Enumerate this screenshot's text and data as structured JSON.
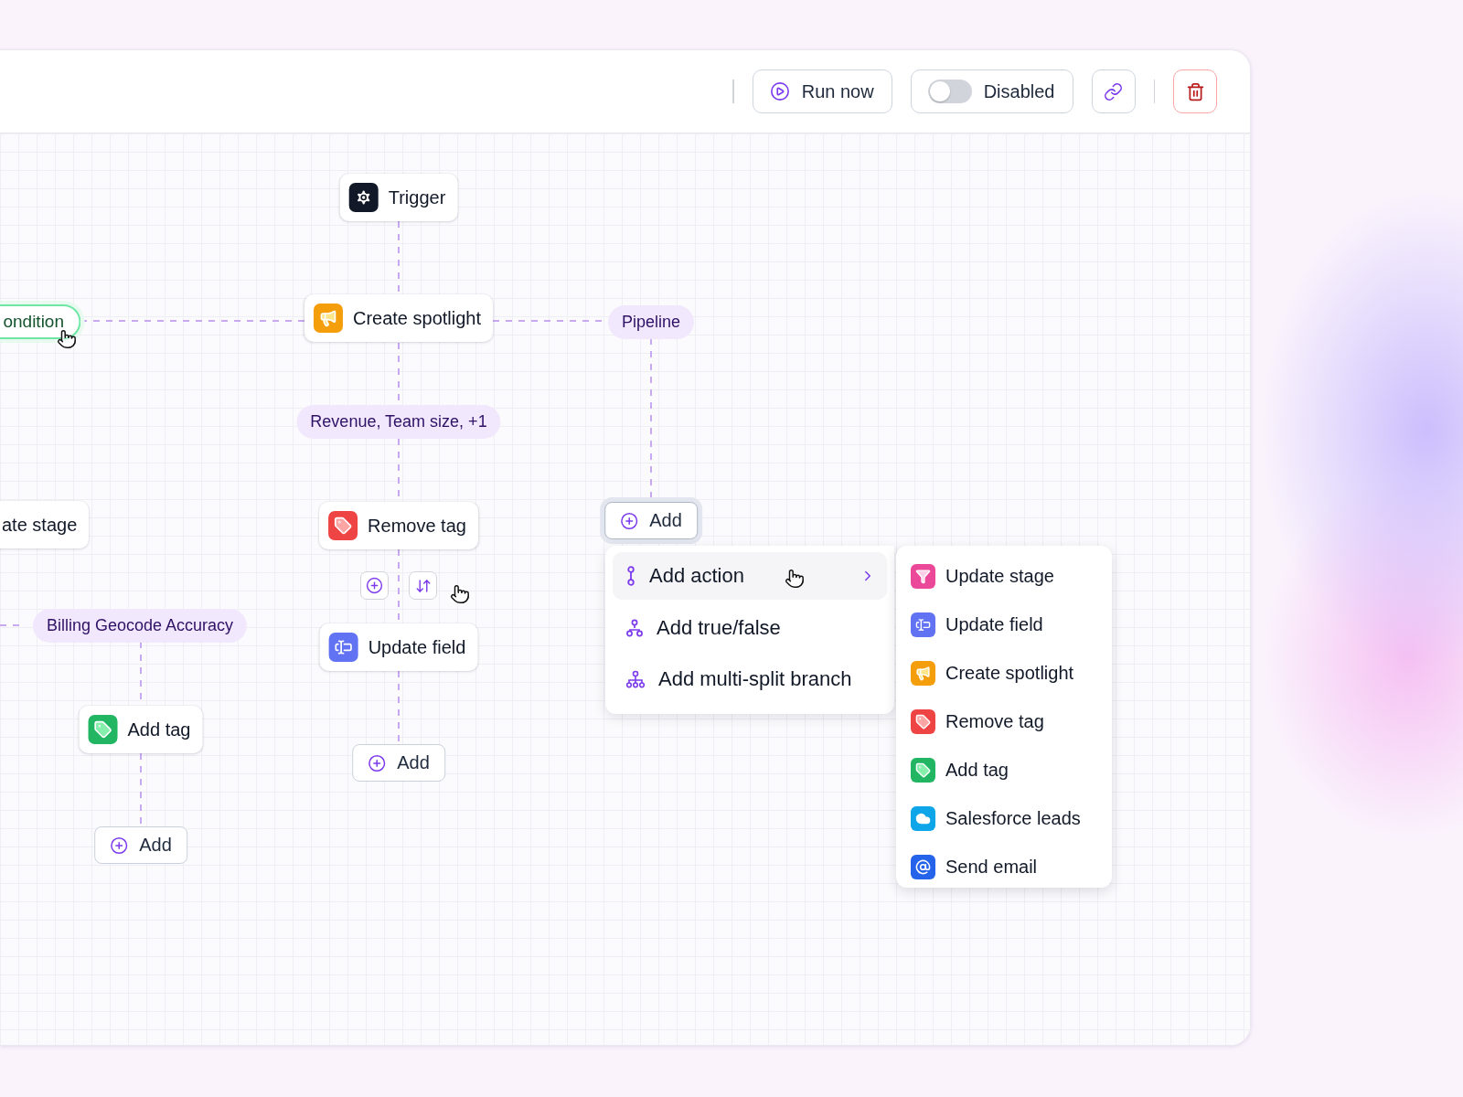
{
  "toolbar": {
    "run_button": {
      "label": "Run now"
    },
    "status_toggle": {
      "label": "Disabled",
      "on": false
    }
  },
  "canvas": {
    "nodes": [
      {
        "kind": "step",
        "label": "Trigger"
      },
      {
        "kind": "condition",
        "label": "ondition"
      },
      {
        "kind": "step",
        "label": "Create spotlight"
      },
      {
        "kind": "pill",
        "label": "Pipeline"
      },
      {
        "kind": "pill",
        "label": "Revenue, Team size, +1"
      },
      {
        "kind": "step",
        "label": "ate stage"
      },
      {
        "kind": "step",
        "label": "Remove tag"
      },
      {
        "kind": "add",
        "label": "Add",
        "focused": true
      },
      {
        "kind": "pill",
        "label": "Billing Geocode Accuracy"
      },
      {
        "kind": "step",
        "label": "Update field"
      },
      {
        "kind": "step",
        "label": "Add tag"
      },
      {
        "kind": "add",
        "label": "Add",
        "focused": false
      },
      {
        "kind": "add",
        "label": "Add",
        "focused": false
      }
    ]
  },
  "menu": {
    "items": [
      {
        "kind": "action",
        "label": "Add action",
        "selected": true
      },
      {
        "kind": "truefalse",
        "label": "Add true/false",
        "selected": false
      },
      {
        "kind": "multisplit",
        "label": "Add multi-split branch",
        "selected": false
      }
    ],
    "submenu": [
      {
        "label": "Update stage"
      },
      {
        "label": "Update field"
      },
      {
        "label": "Create spotlight"
      },
      {
        "label": "Remove tag"
      },
      {
        "label": "Add tag"
      },
      {
        "label": "Salesforce leads"
      },
      {
        "label": "Send email"
      }
    ]
  }
}
